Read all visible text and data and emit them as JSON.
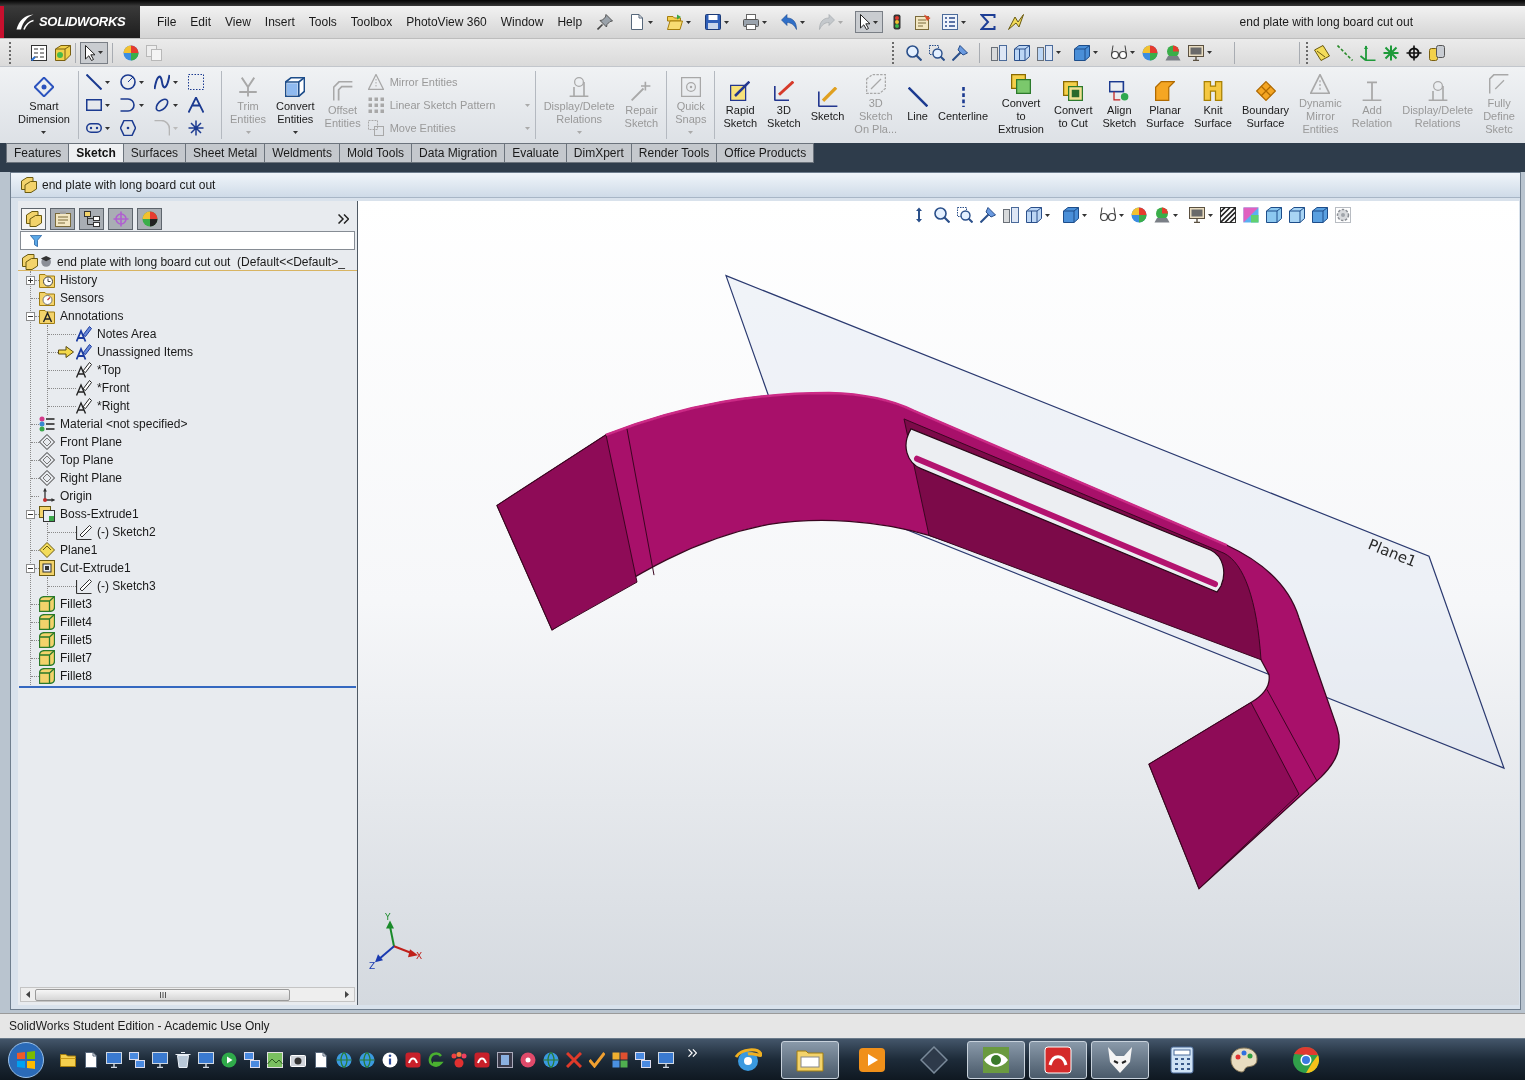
{
  "window": {
    "title": "end plate with long board cut out"
  },
  "logo": {
    "text": "SOLIDWORKS"
  },
  "menu": [
    "File",
    "Edit",
    "View",
    "Insert",
    "Tools",
    "Toolbox",
    "PhotoView 360",
    "Window",
    "Help"
  ],
  "toolbars": [
    {
      "select_active": true
    },
    {
      "select_active": true
    }
  ],
  "command_manager": {
    "groups": [
      {
        "items": [
          {
            "kind": "large",
            "label": "Smart\nDimension",
            "disabled": false,
            "has_menu": true
          }
        ]
      },
      {
        "items": [
          {
            "kind": "sketch-tools"
          }
        ]
      },
      {
        "items": [
          {
            "kind": "large",
            "label": "Trim\nEntities",
            "disabled": true,
            "has_menu": true
          },
          {
            "kind": "large",
            "label": "Convert\nEntities",
            "disabled": false,
            "has_menu": true
          },
          {
            "kind": "large",
            "label": "Offset\nEntities",
            "disabled": true,
            "has_menu": false
          },
          {
            "kind": "stack",
            "entries": [
              {
                "label": "Mirror Entities",
                "disabled": true,
                "has_menu": false
              },
              {
                "label": "Linear Sketch Pattern",
                "disabled": true,
                "has_menu": true
              },
              {
                "label": "Move Entities",
                "disabled": true,
                "has_menu": true
              }
            ]
          }
        ]
      },
      {
        "items": [
          {
            "kind": "large",
            "label": "Display/Delete\nRelations",
            "disabled": true,
            "has_menu": true
          },
          {
            "kind": "large",
            "label": "Repair\nSketch",
            "disabled": true,
            "has_menu": false
          }
        ]
      },
      {
        "items": [
          {
            "kind": "large",
            "label": "Quick\nSnaps",
            "disabled": true,
            "has_menu": true
          }
        ]
      },
      {
        "items": [
          {
            "kind": "large",
            "label": "Rapid\nSketch",
            "disabled": false,
            "has_menu": false
          },
          {
            "kind": "large",
            "label": "3D\nSketch",
            "disabled": false,
            "has_menu": false
          },
          {
            "kind": "large",
            "label": "Sketch",
            "disabled": false,
            "has_menu": false
          },
          {
            "kind": "large",
            "label": "3D\nSketch\nOn Pla...",
            "disabled": true,
            "has_menu": false
          },
          {
            "kind": "large",
            "label": "Line",
            "disabled": false,
            "has_menu": false
          },
          {
            "kind": "large",
            "label": "Centerline",
            "disabled": false,
            "has_menu": false
          },
          {
            "kind": "large",
            "label": "Convert\nto\nExtrusion",
            "disabled": false,
            "has_menu": false
          },
          {
            "kind": "large",
            "label": "Convert\nto Cut",
            "disabled": false,
            "has_menu": false
          },
          {
            "kind": "large",
            "label": "Align\nSketch",
            "disabled": false,
            "has_menu": false
          },
          {
            "kind": "large",
            "label": "Planar\nSurface",
            "disabled": false,
            "has_menu": false
          },
          {
            "kind": "large",
            "label": "Knit\nSurface",
            "disabled": false,
            "has_menu": false
          },
          {
            "kind": "large",
            "label": "Boundary\nSurface",
            "disabled": false,
            "has_menu": false
          },
          {
            "kind": "large",
            "label": "Dynamic\nMirror\nEntities",
            "disabled": true,
            "has_menu": false
          },
          {
            "kind": "large",
            "label": "Add\nRelation",
            "disabled": true,
            "has_menu": false
          },
          {
            "kind": "large",
            "label": "Display/Delete\nRelations",
            "disabled": true,
            "has_menu": false
          },
          {
            "kind": "large",
            "label": "Fully\nDefine\nSketc",
            "disabled": true,
            "has_menu": false
          }
        ]
      }
    ]
  },
  "tabs": [
    {
      "label": "Features",
      "selected": false
    },
    {
      "label": "Sketch",
      "selected": true
    },
    {
      "label": "Surfaces",
      "selected": false
    },
    {
      "label": "Sheet Metal",
      "selected": false
    },
    {
      "label": "Weldments",
      "selected": false
    },
    {
      "label": "Mold Tools",
      "selected": false
    },
    {
      "label": "Data Migration",
      "selected": false
    },
    {
      "label": "Evaluate",
      "selected": false
    },
    {
      "label": "DimXpert",
      "selected": false
    },
    {
      "label": "Render Tools",
      "selected": false
    },
    {
      "label": "Office Products",
      "selected": false
    }
  ],
  "document": {
    "title": "end plate with long board cut out",
    "panel_tabs": [
      {
        "kind": "feature-tree",
        "selected": true
      },
      {
        "kind": "properties",
        "selected": false
      },
      {
        "kind": "configurations",
        "selected": false
      },
      {
        "kind": "dimxpert",
        "selected": false
      },
      {
        "kind": "display",
        "selected": false
      }
    ],
    "feature_tree": {
      "root": "end plate with long board cut out  (Default<<Default>_",
      "items": [
        {
          "kind": "history",
          "label": "History",
          "expanded": false
        },
        {
          "kind": "sensors",
          "label": "Sensors"
        },
        {
          "kind": "annotations",
          "label": "Annotations",
          "expanded": true,
          "children": [
            {
              "kind": "note",
              "label": "Notes Area"
            },
            {
              "kind": "unassigned",
              "label": "Unassigned Items"
            },
            {
              "kind": "annotation-view",
              "label": "*Top"
            },
            {
              "kind": "annotation-view",
              "label": "*Front"
            },
            {
              "kind": "annotation-view",
              "label": "*Right"
            }
          ]
        },
        {
          "kind": "material",
          "label": "Material <not specified>"
        },
        {
          "kind": "plane",
          "label": "Front Plane"
        },
        {
          "kind": "plane",
          "label": "Top Plane"
        },
        {
          "kind": "plane",
          "label": "Right Plane"
        },
        {
          "kind": "origin",
          "label": "Origin"
        },
        {
          "kind": "boss-extrude",
          "label": "Boss-Extrude1",
          "expanded": true,
          "children": [
            {
              "kind": "sketch",
              "label": "(-) Sketch2"
            }
          ]
        },
        {
          "kind": "ref-plane",
          "label": "Plane1"
        },
        {
          "kind": "cut-extrude",
          "label": "Cut-Extrude1",
          "expanded": true,
          "children": [
            {
              "kind": "sketch",
              "label": "(-) Sketch3"
            }
          ]
        },
        {
          "kind": "fillet",
          "label": "Fillet3"
        },
        {
          "kind": "fillet",
          "label": "Fillet4"
        },
        {
          "kind": "fillet",
          "label": "Fillet5"
        },
        {
          "kind": "fillet",
          "label": "Fillet7"
        },
        {
          "kind": "fillet",
          "label": "Fillet8"
        }
      ]
    }
  },
  "viewport": {
    "plane_label": "Plane1",
    "axes": [
      {
        "kind": "x",
        "label": "X"
      },
      {
        "kind": "y",
        "label": "Y"
      },
      {
        "kind": "z",
        "label": "Z"
      }
    ]
  },
  "status_bar": {
    "text": "SolidWorks Student Edition - Academic Use Only"
  },
  "taskbar": {
    "apps": [
      {
        "kind": "browser",
        "running": false
      },
      {
        "kind": "folder",
        "running": true
      },
      {
        "kind": "media",
        "running": false
      },
      {
        "kind": "r-app",
        "running": false
      },
      {
        "kind": "image-viewer",
        "running": true
      },
      {
        "kind": "cad",
        "running": true
      },
      {
        "kind": "fox",
        "running": true
      },
      {
        "kind": "calculator",
        "running": false
      },
      {
        "kind": "paint",
        "running": false
      },
      {
        "kind": "chrome",
        "running": false
      }
    ]
  }
}
